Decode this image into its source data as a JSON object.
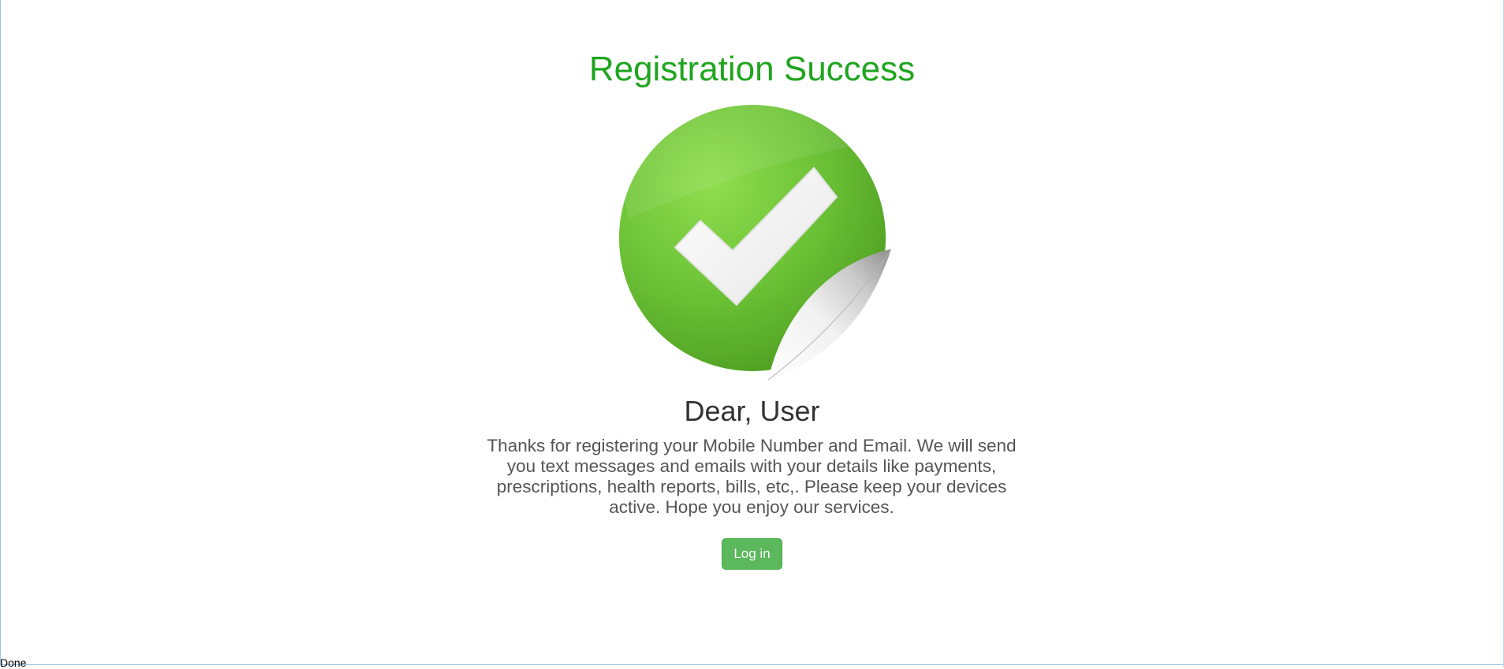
{
  "page": {
    "title": "Registration Success",
    "greeting": "Dear, User",
    "message": "Thanks for registering your Mobile Number and Email. We will send you text messages and emails with your details like payments, prescriptions, health reports, bills, etc,. Please keep your devices active. Hope you enjoy our services.",
    "login_label": "Log in"
  },
  "status_bar": {
    "text": "Done"
  },
  "icons": {
    "success_badge": "checkmark-sticker-icon"
  },
  "colors": {
    "title": "#1fa51f",
    "badge_green": "#6cc236",
    "button": "#5cb85c"
  }
}
